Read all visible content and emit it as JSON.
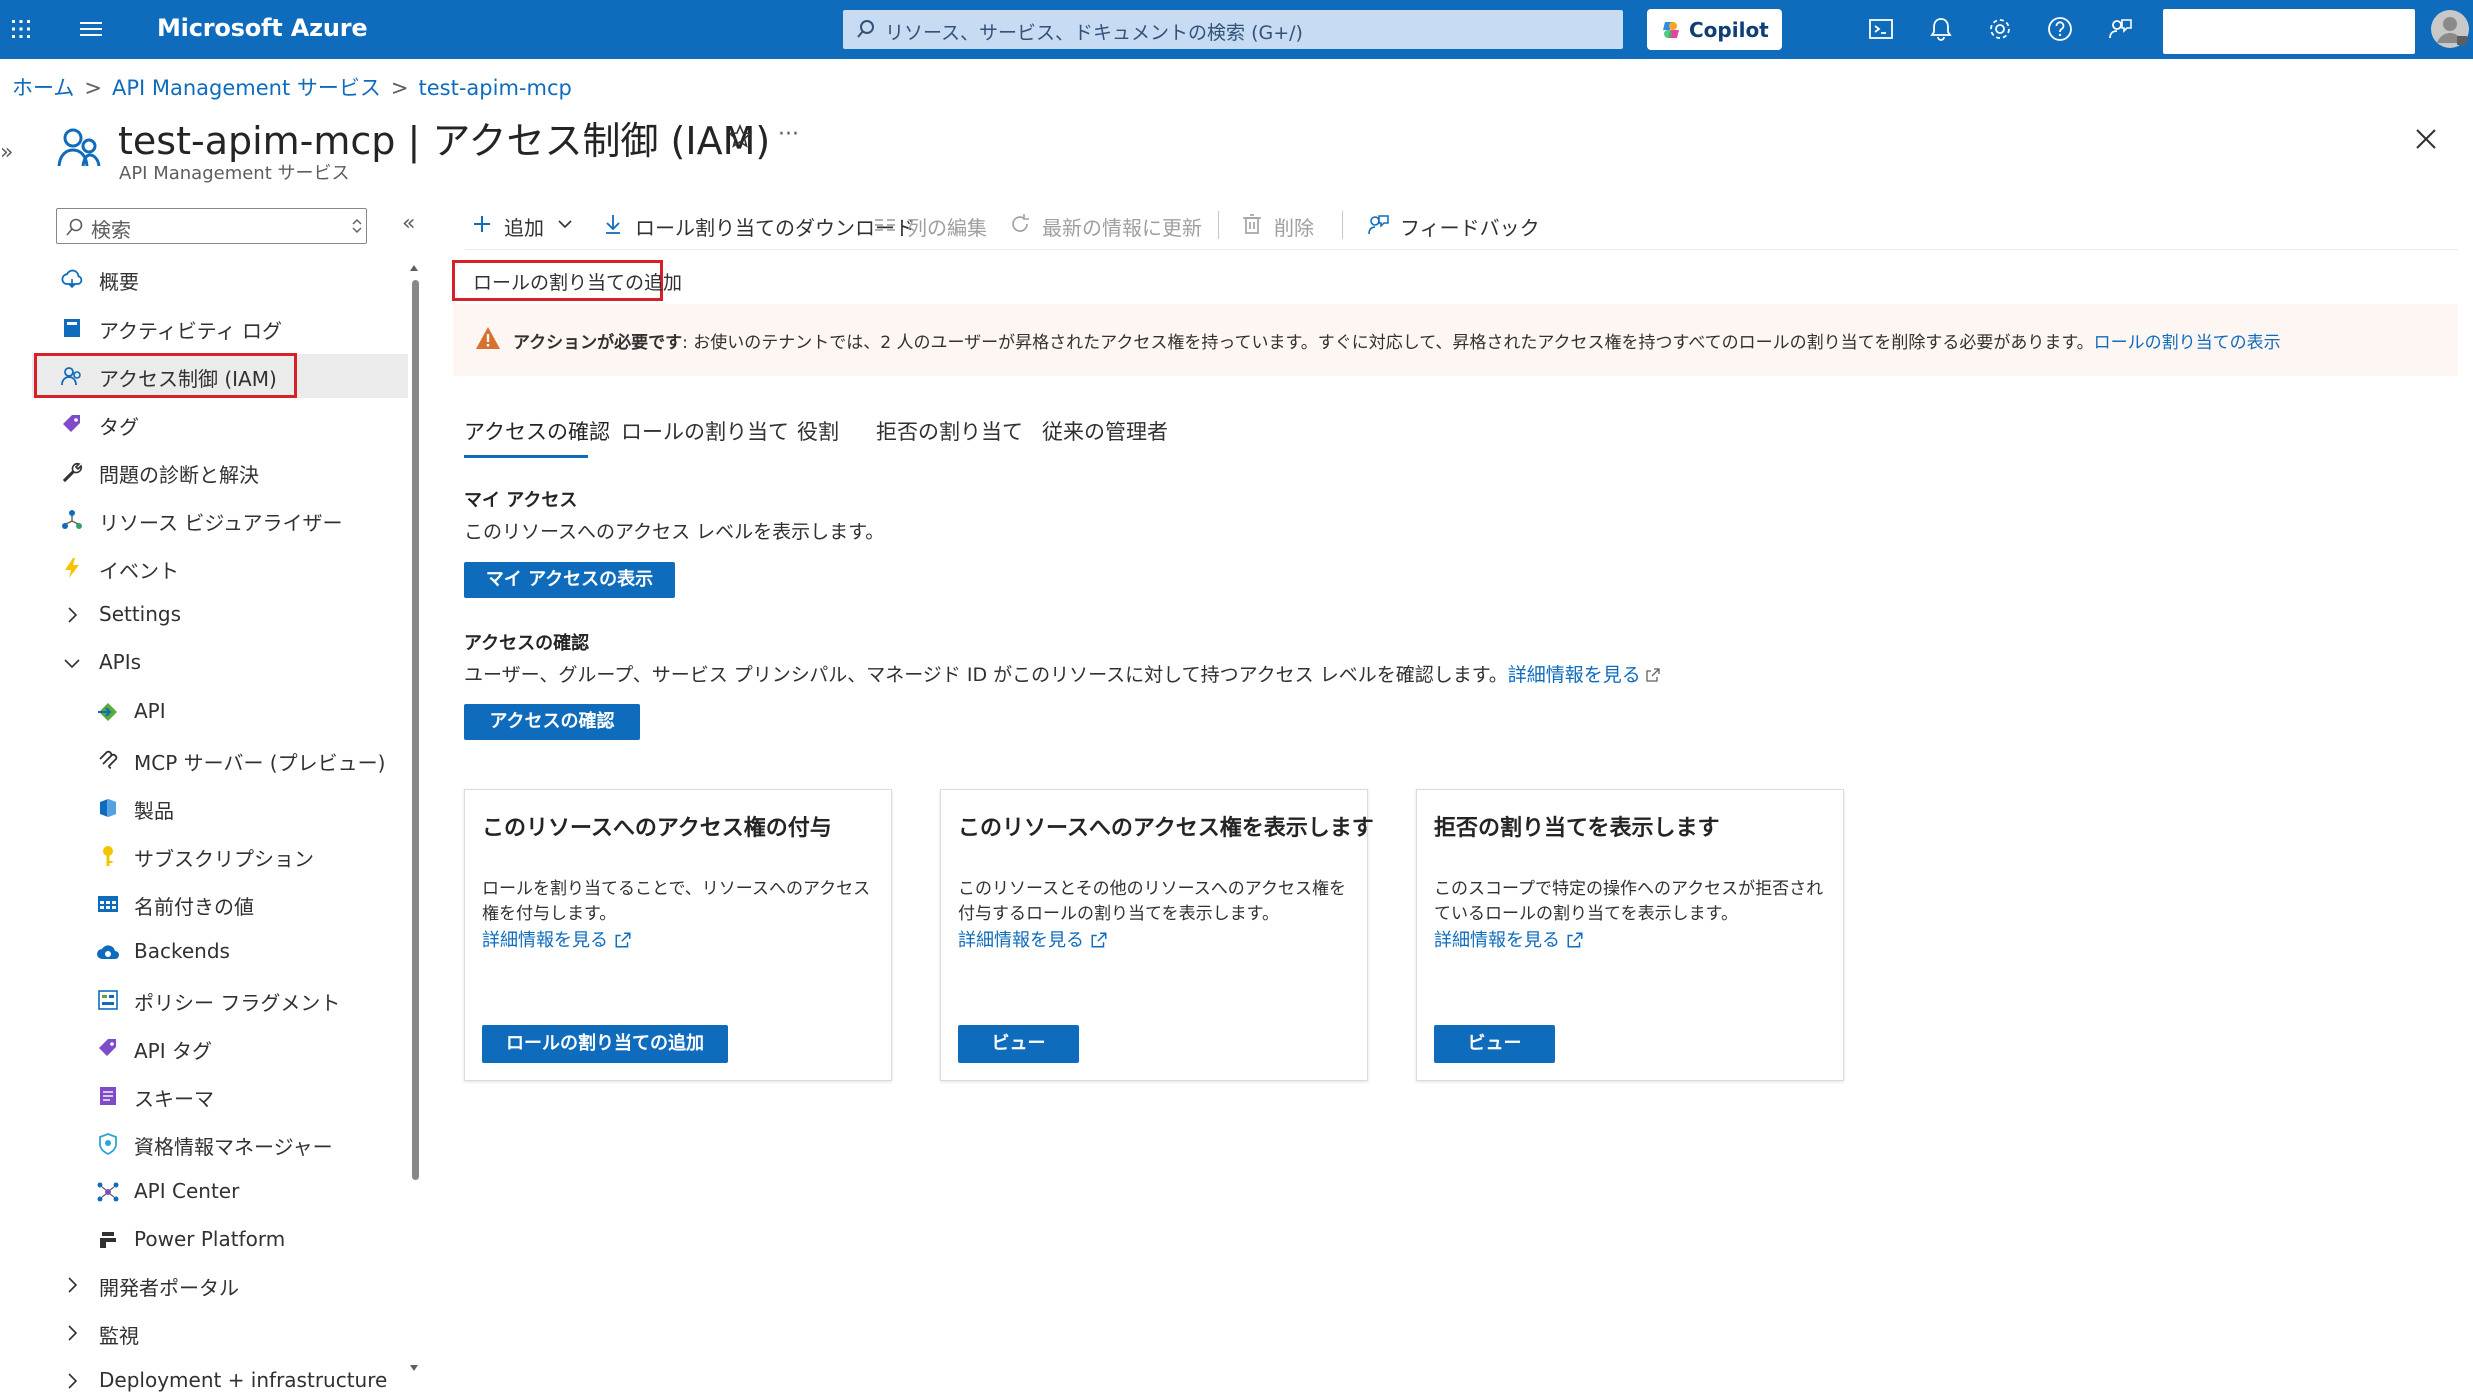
{
  "topbar": {
    "brand": "Microsoft Azure",
    "search_placeholder": "リソース、サービス、ドキュメントの検索 (G+/)",
    "copilot_label": "Copilot",
    "icons": [
      "cloud-shell-icon",
      "bell-icon",
      "gear-icon",
      "help-icon",
      "feedback-icon"
    ],
    "brand_color": "#0f6cbd"
  },
  "breadcrumb": [
    "ホーム",
    "API Management サービス",
    "test-apim-mcp"
  ],
  "header": {
    "title": "test-apim-mcp | アクセス制御 (IAM)",
    "subtitle": "API Management サービス",
    "more": "···"
  },
  "sidebar": {
    "search_placeholder": "検索",
    "collapse": "«",
    "expand": "»",
    "items": [
      {
        "label": "概要",
        "icon": "overview-icon"
      },
      {
        "label": "アクティビティ ログ",
        "icon": "activity-log-icon"
      },
      {
        "label": "アクセス制御 (IAM)",
        "icon": "iam-icon",
        "selected": true
      },
      {
        "label": "タグ",
        "icon": "tag-icon"
      },
      {
        "label": "問題の診断と解決",
        "icon": "wrench-icon"
      },
      {
        "label": "リソース ビジュアライザー",
        "icon": "visualizer-icon"
      },
      {
        "label": "イベント",
        "icon": "lightning-icon"
      },
      {
        "label": "Settings",
        "icon": "chevron-right-icon"
      },
      {
        "label": "APIs",
        "icon": "chevron-down-icon"
      },
      {
        "label": "API",
        "icon": "api-icon"
      },
      {
        "label": "MCP サーバー (プレビュー)",
        "icon": "mcp-icon"
      },
      {
        "label": "製品",
        "icon": "product-icon"
      },
      {
        "label": "サブスクリプション",
        "icon": "key-icon"
      },
      {
        "label": "名前付きの値",
        "icon": "named-values-icon"
      },
      {
        "label": "Backends",
        "icon": "cloud-icon"
      },
      {
        "label": "ポリシー フラグメント",
        "icon": "policy-fragment-icon"
      },
      {
        "label": "API タグ",
        "icon": "api-tag-icon"
      },
      {
        "label": "スキーマ",
        "icon": "schema-icon"
      },
      {
        "label": "資格情報マネージャー",
        "icon": "credential-icon"
      },
      {
        "label": "API Center",
        "icon": "api-center-icon"
      },
      {
        "label": "Power Platform",
        "icon": "power-platform-icon"
      },
      {
        "label": "開発者ポータル",
        "icon": "chevron-right-icon"
      },
      {
        "label": "監視",
        "icon": "chevron-right-icon"
      },
      {
        "label": "Deployment + infrastructure",
        "icon": "chevron-right-icon"
      }
    ]
  },
  "toolbar": {
    "add": "追加",
    "download": "ロール割り当てのダウンロード",
    "edit_columns": "列の編集",
    "refresh": "最新の情報に更新",
    "delete": "削除",
    "feedback": "フィードバック"
  },
  "role_hint": "ロールの割り当ての追加",
  "warning": {
    "bold": "アクションが必要です",
    "text": ": お使いのテナントでは、2 人のユーザーが昇格されたアクセス権を持っています。すぐに対応して、昇格されたアクセス権を持つすべてのロールの割り当てを削除する必要があります。",
    "link": "ロールの割り当ての表示"
  },
  "tabs": [
    "アクセスの確認",
    "ロールの割り当て",
    "役割",
    "拒否の割り当て",
    "従来の管理者"
  ],
  "my_access": {
    "title": "マイ アクセス",
    "desc": "このリソースへのアクセス レベルを表示します。",
    "button": "マイ アクセスの表示"
  },
  "check_access": {
    "title": "アクセスの確認",
    "desc": "ユーザー、グループ、サービス プリンシパル、マネージド ID がこのリソースに対して持つアクセス レベルを確認します。",
    "link": "詳細情報を見る",
    "button": "アクセスの確認"
  },
  "cards": [
    {
      "title": "このリソースへのアクセス権の付与",
      "desc": "ロールを割り当てることで、リソースへのアクセス権を付与します。",
      "link": "詳細情報を見る",
      "button": "ロールの割り当ての追加"
    },
    {
      "title": "このリソースへのアクセス権を表示します",
      "desc": "このリソースとその他のリソースへのアクセス権を付与するロールの割り当てを表示します。",
      "link": "詳細情報を見る",
      "button": "ビュー"
    },
    {
      "title": "拒否の割り当てを表示します",
      "desc": "このスコープで特定の操作へのアクセスが拒否されているロールの割り当てを表示します。",
      "link": "詳細情報を見る",
      "button": "ビュー"
    }
  ]
}
